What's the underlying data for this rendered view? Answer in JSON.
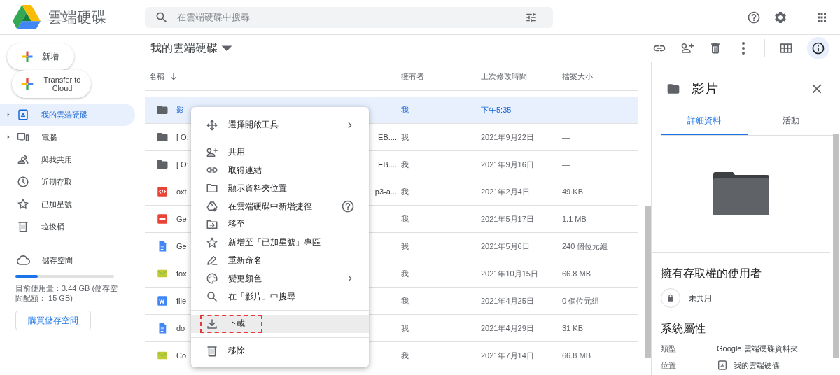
{
  "app": {
    "title": "雲端硬碟"
  },
  "search": {
    "placeholder": "在雲端硬碟中搜尋"
  },
  "sidebar": {
    "new_button": "新增",
    "transfer_button": "Transfer to Cloud",
    "items": [
      {
        "label": "我的雲端硬碟",
        "selected": true,
        "expandable": true
      },
      {
        "label": "電腦",
        "selected": false,
        "expandable": true
      },
      {
        "label": "與我共用",
        "selected": false,
        "expandable": false
      },
      {
        "label": "近期存取",
        "selected": false,
        "expandable": false
      },
      {
        "label": "已加星號",
        "selected": false,
        "expandable": false
      },
      {
        "label": "垃圾桶",
        "selected": false,
        "expandable": false
      }
    ],
    "storage": {
      "label": "儲存空間",
      "level": 0.23,
      "usage": "目前使用量：3.44 GB (儲存空間配額： 15 GB)",
      "buy_button": "購買儲存空間"
    }
  },
  "toolbar": {
    "title": "我的雲端硬碟",
    "actions": [
      {
        "selected": false
      },
      {
        "selected": false
      },
      {
        "selected": false
      },
      {
        "selected": false
      },
      {
        "selected": false
      },
      {
        "selected": true
      }
    ]
  },
  "table": {
    "columns": [
      "名稱",
      "擁有者",
      "上次修改時間",
      "檔案大小"
    ],
    "rows": [
      {
        "kind": "folder",
        "name": "影",
        "owner": "我",
        "modified": "下午5:35",
        "size": "—",
        "selected": true
      },
      {
        "kind": "folder",
        "name": "[ O:",
        "name_tail": "EB....",
        "owner": "我",
        "modified": "2021年9月22日",
        "size": "—",
        "selected": false
      },
      {
        "kind": "folder",
        "name": "[ O:",
        "name_tail": "EB....",
        "owner": "我",
        "modified": "2021年9月16日",
        "size": "—",
        "selected": false
      },
      {
        "kind": "code",
        "name": "oxt",
        "name_tail": "p3-a...",
        "owner": "我",
        "modified": "2021年2月4日",
        "size": "49 KB",
        "selected": false
      },
      {
        "kind": "pdf",
        "name": "Ge",
        "owner": "我",
        "modified": "2021年5月17日",
        "size": "1.1 MB",
        "selected": false
      },
      {
        "kind": "doc",
        "name": "Ge",
        "owner": "我",
        "modified": "2021年5月6日",
        "size": "240 個位元組",
        "selected": false
      },
      {
        "kind": "image",
        "name": "fox",
        "owner": "我",
        "modified": "2021年10月15日",
        "size": "66.8 MB",
        "selected": false
      },
      {
        "kind": "word",
        "name": "file",
        "owner": "我",
        "modified": "2021年4月25日",
        "size": "0 個位元組",
        "selected": false
      },
      {
        "kind": "doc",
        "name": "do",
        "owner": "我",
        "modified": "2021年4月29日",
        "size": "31 KB",
        "selected": false
      },
      {
        "kind": "image",
        "name": "Co",
        "owner": "我",
        "modified": "2021年7月14日",
        "size": "66.8 MB",
        "selected": false
      }
    ]
  },
  "context_menu": {
    "items": [
      {
        "kind": "item",
        "label": "選擇開啟工具",
        "submenu": true,
        "help": false,
        "highlighted": false
      },
      {
        "kind": "divider"
      },
      {
        "kind": "item",
        "label": "共用",
        "submenu": false,
        "help": false,
        "highlighted": false
      },
      {
        "kind": "item",
        "label": "取得連結",
        "submenu": false,
        "help": false,
        "highlighted": false
      },
      {
        "kind": "item",
        "label": "顯示資料夾位置",
        "submenu": false,
        "help": false,
        "highlighted": false
      },
      {
        "kind": "item",
        "label": "在雲端硬碟中新增捷徑",
        "submenu": false,
        "help": true,
        "highlighted": false
      },
      {
        "kind": "item",
        "label": "移至",
        "submenu": false,
        "help": false,
        "highlighted": false
      },
      {
        "kind": "item",
        "label": "新增至「已加星號」專區",
        "submenu": false,
        "help": false,
        "highlighted": false
      },
      {
        "kind": "item",
        "label": "重新命名",
        "submenu": false,
        "help": false,
        "highlighted": false
      },
      {
        "kind": "item",
        "label": "變更顏色",
        "submenu": true,
        "help": false,
        "highlighted": false
      },
      {
        "kind": "item",
        "label": "在「影片」中搜尋",
        "submenu": false,
        "help": false,
        "highlighted": false
      },
      {
        "kind": "divider"
      },
      {
        "kind": "item",
        "label": "下載",
        "submenu": false,
        "help": false,
        "highlighted": true
      },
      {
        "kind": "divider"
      },
      {
        "kind": "item",
        "label": "移除",
        "submenu": false,
        "help": false,
        "highlighted": false
      }
    ]
  },
  "details": {
    "title": "影片",
    "tabs": [
      {
        "label": "詳細資料",
        "selected": true
      },
      {
        "label": "活動",
        "selected": false
      }
    ],
    "access_heading": "擁有存取權的使用者",
    "sharing": "未共用",
    "properties_heading": "系統屬性",
    "properties": [
      {
        "kind": "text",
        "label": "類型",
        "value": "Google 雲端硬碟資料夾"
      },
      {
        "kind": "location",
        "label": "位置",
        "value": "我的雲端硬碟"
      }
    ]
  }
}
